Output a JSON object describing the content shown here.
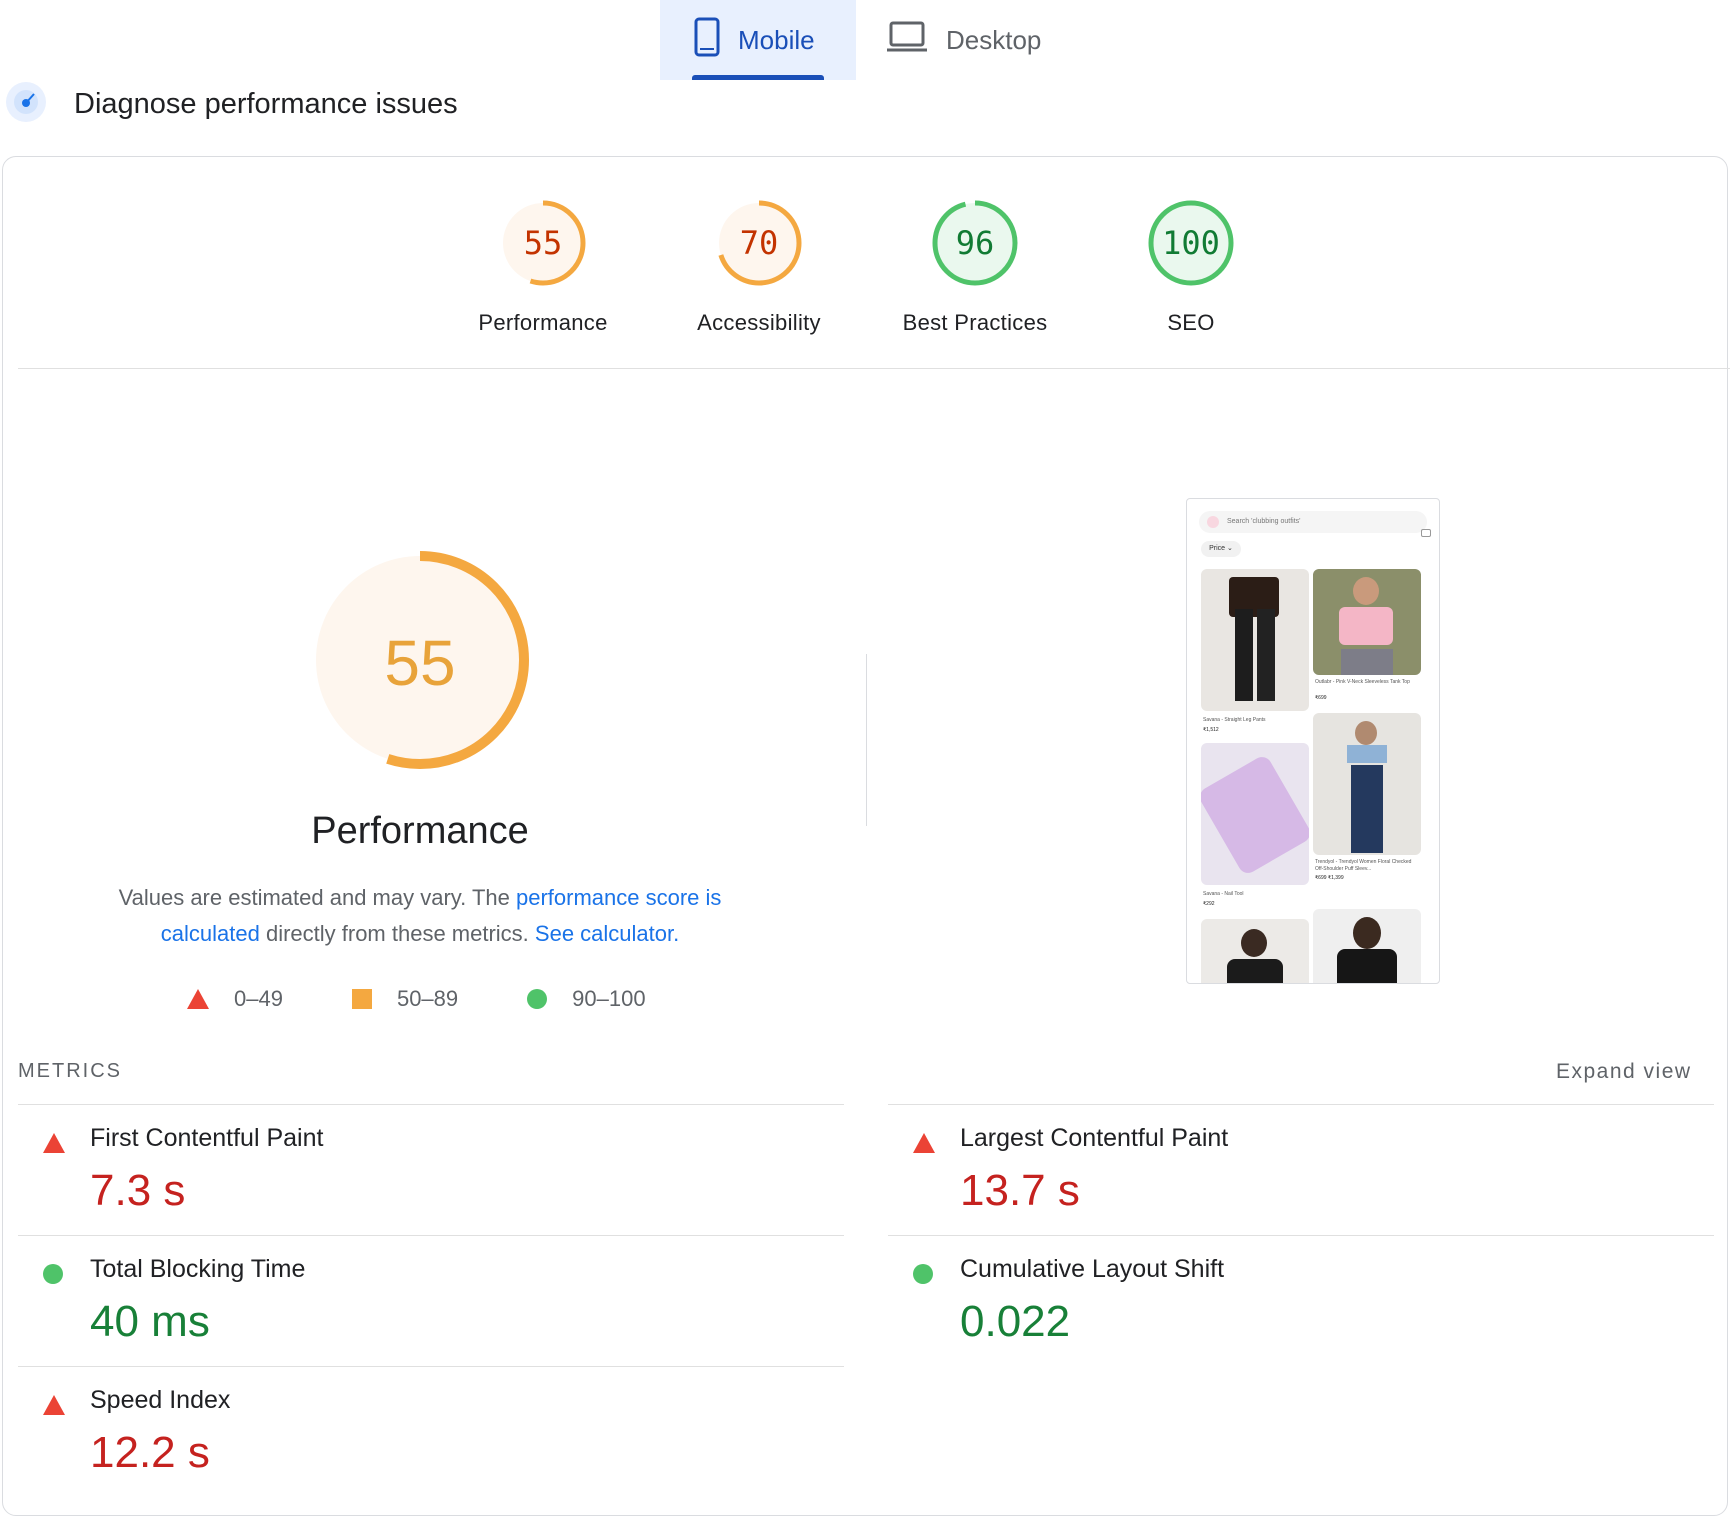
{
  "tabs": [
    {
      "label": "Mobile",
      "icon": "phone-icon",
      "active": true
    },
    {
      "label": "Desktop",
      "icon": "laptop-icon",
      "active": false
    }
  ],
  "header": {
    "title": "Diagnose performance issues",
    "icon": "gauge-icon"
  },
  "categories": [
    {
      "score": "55",
      "label": "Performance",
      "status": "average",
      "value": 55
    },
    {
      "score": "70",
      "label": "Accessibility",
      "status": "average",
      "value": 70
    },
    {
      "score": "96",
      "label": "Best Practices",
      "status": "good",
      "value": 96
    },
    {
      "score": "100",
      "label": "SEO",
      "status": "good",
      "value": 100
    }
  ],
  "performance": {
    "score": "55",
    "title": "Performance",
    "desc_pre": "Values are estimated and may vary. The ",
    "desc_link1": "performance score is calculated",
    "desc_mid": " directly from these metrics. ",
    "desc_link2": "See calculator."
  },
  "legend": [
    {
      "range": "0–49",
      "shape": "triangle"
    },
    {
      "range": "50–89",
      "shape": "square"
    },
    {
      "range": "90–100",
      "shape": "circle"
    }
  ],
  "screenshot": {
    "search_placeholder": "Search 'clubbing outfits'",
    "filter": "Price",
    "items": [
      {
        "caption": "Savana - Straight Leg Pants",
        "price": "₹1,512"
      },
      {
        "caption": "Outlabr - Pink V-Neck Sleeveless Tank Top",
        "price": "₹699"
      },
      {
        "caption": "Savana - Nail Tool",
        "price": "₹292"
      },
      {
        "caption": "Trendyol - Trendyol Women Floral Checked Off-Shoulder Puff Sleev...",
        "price": "₹699 ₹1,399"
      }
    ]
  },
  "metrics_section": {
    "title": "METRICS",
    "expand": "Expand view"
  },
  "metrics": [
    {
      "name": "First Contentful Paint",
      "value": "7.3 s",
      "status": "poor"
    },
    {
      "name": "Largest Contentful Paint",
      "value": "13.7 s",
      "status": "poor"
    },
    {
      "name": "Total Blocking Time",
      "value": "40 ms",
      "status": "good"
    },
    {
      "name": "Cumulative Layout Shift",
      "value": "0.022",
      "status": "good"
    },
    {
      "name": "Speed Index",
      "value": "12.2 s",
      "status": "poor"
    }
  ],
  "colors": {
    "average": "#f4a840",
    "average_text": "#c33300",
    "good": "#4fc369",
    "good_text": "#117b34",
    "poor": "#eb4335",
    "accent": "#1a73e8"
  }
}
